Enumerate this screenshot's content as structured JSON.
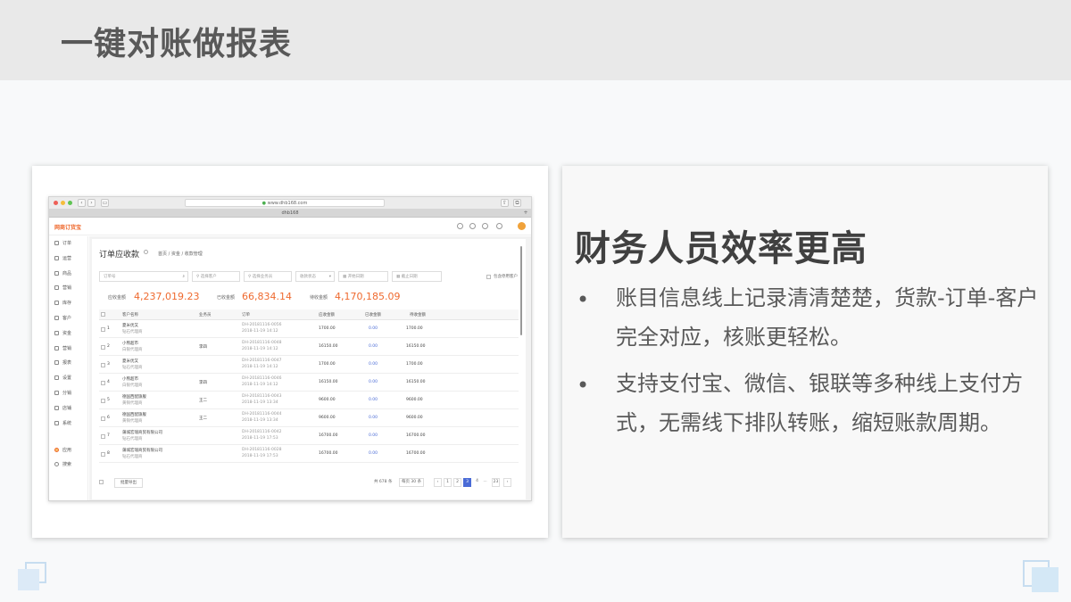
{
  "slide": {
    "title": "一键对账做报表",
    "heading": "财务人员效率更高",
    "bullets": [
      "账目信息线上记录清清楚楚，货款-订单-客户完全对应，核账更轻松。",
      "支持支付宝、微信、银联等多种线上支付方式，无需线下排队转账，缩短账款周期。"
    ],
    "bullet_symbol": "•"
  },
  "browser": {
    "url": "www.dhb168.com",
    "tab_title": "dhb168",
    "app_logo": "网商订货宝",
    "sidebar": [
      "订单",
      "运营",
      "商品",
      "营销",
      "库存",
      "客户",
      "资金",
      "营销",
      "报表",
      "设置",
      "分销",
      "店铺",
      "系统"
    ],
    "sidebar_bottom": [
      "应用",
      "搜索"
    ],
    "page_title": "订单应收款",
    "breadcrumb": "首页 / 资金 / 收款管理",
    "filters": {
      "order_no": "订单号",
      "customer": "选择客户",
      "salesperson": "选择业务员",
      "status": "收款状态",
      "start": "开始日期",
      "end": "截止日期",
      "show_cancelled": "包含停用客户"
    },
    "stats": [
      {
        "label": "应收金额",
        "value": "4,237,019.23"
      },
      {
        "label": "已收金额",
        "value": "66,834.14"
      },
      {
        "label": "待收金额",
        "value": "4,170,185.09"
      }
    ],
    "columns": [
      "客户名称",
      "业务员",
      "订单",
      "应收金额",
      "已收金额",
      "待收金额"
    ],
    "rows": [
      {
        "idx": "1",
        "name": "夏米优又",
        "sub": "钻石代理商",
        "sales": "",
        "order": "DH-20181116-0056",
        "date": "2018-11-19 14:12",
        "due": "1700.00",
        "paid": "0.00",
        "owed": "1700.00"
      },
      {
        "idx": "2",
        "name": "小熊超市",
        "sub": "白银代理商",
        "sales": "李四",
        "order": "DH-20181116-0048",
        "date": "2018-11-19 14:12",
        "due": "16150.00",
        "paid": "0.00",
        "owed": "16150.00"
      },
      {
        "idx": "3",
        "name": "夏米优又",
        "sub": "钻石代理商",
        "sales": "",
        "order": "DH-20181116-0047",
        "date": "2018-11-19 14:12",
        "due": "1700.00",
        "paid": "0.00",
        "owed": "1700.00"
      },
      {
        "idx": "4",
        "name": "小熊超市",
        "sub": "白银代理商",
        "sales": "李四",
        "order": "DH-20181116-0046",
        "date": "2018-11-19 14:12",
        "due": "16150.00",
        "paid": "0.00",
        "owed": "16150.00"
      },
      {
        "idx": "5",
        "name": "德国西配旗舰",
        "sub": "黄铜代理商",
        "sales": "王二",
        "order": "DH-20181116-0043",
        "date": "2018-11-19 13:34",
        "due": "9600.00",
        "paid": "0.00",
        "owed": "9600.00"
      },
      {
        "idx": "6",
        "name": "德国西配旗舰",
        "sub": "黄铜代理商",
        "sales": "王二",
        "order": "DH-20181116-0044",
        "date": "2018-11-19 13:34",
        "due": "9600.00",
        "paid": "0.00",
        "owed": "9600.00"
      },
      {
        "idx": "7",
        "name": "蒲城宏瑞商贸有限公司",
        "sub": "钻石代理商",
        "sales": "",
        "order": "DH-20181116-0042",
        "date": "2018-11-19 17:53",
        "due": "16700.00",
        "paid": "0.00",
        "owed": "16700.00"
      },
      {
        "idx": "8",
        "name": "蒲城宏瑞商贸有限公司",
        "sub": "钻石代理商",
        "sales": "",
        "order": "DH-20181116-0028",
        "date": "2018-11-19 17:53",
        "due": "16700.00",
        "paid": "0.00",
        "owed": "16700.00"
      }
    ],
    "footer": {
      "export": "批量导出",
      "total": "共 678 条",
      "per_page": "每页 30 条",
      "pages": [
        "1",
        "2",
        "3",
        "4",
        "...",
        "23"
      ],
      "prev": "‹",
      "next": "›"
    }
  },
  "colors": {
    "accent": "#ef6a2f",
    "link": "#4a6bd6",
    "title_band": "#e9e9e9"
  }
}
